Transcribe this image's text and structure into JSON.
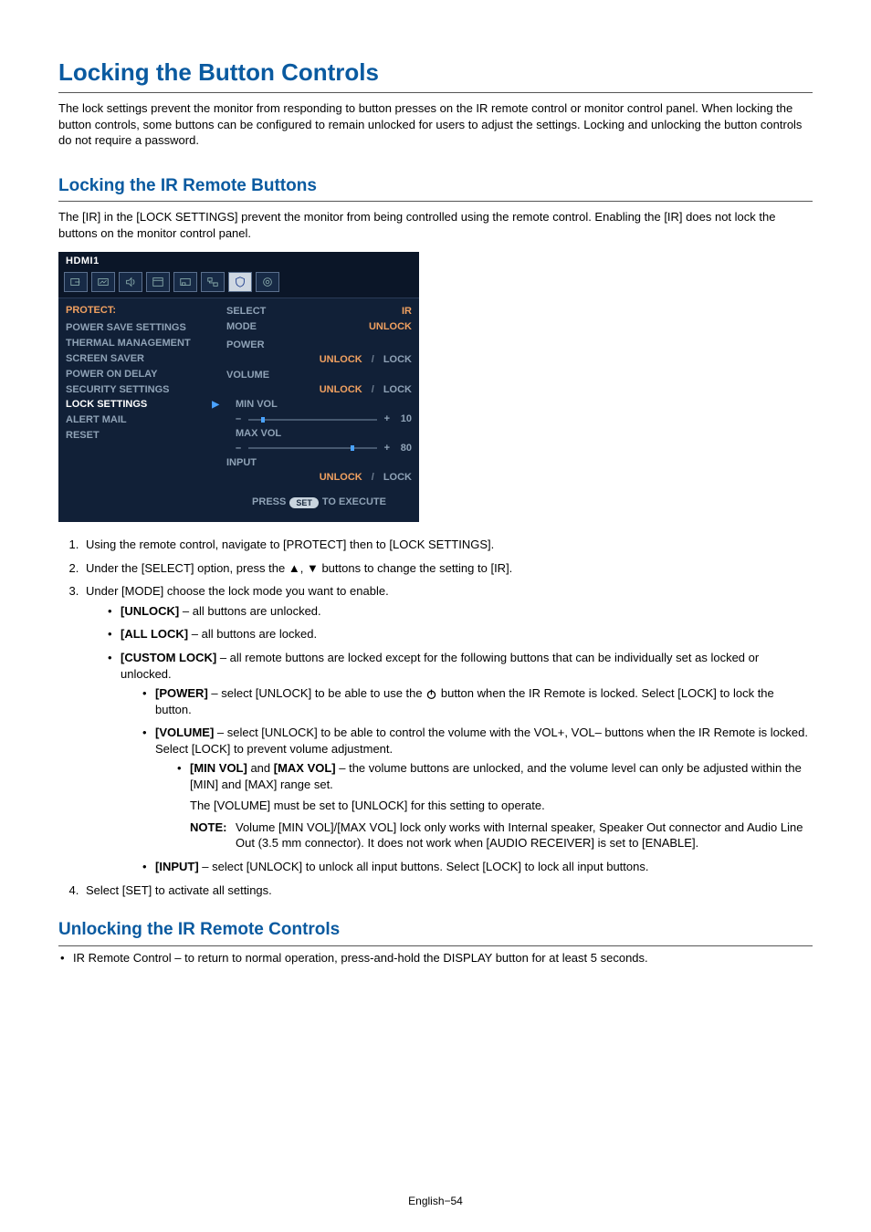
{
  "title": "Locking the Button Controls",
  "intro": "The lock settings prevent the monitor from responding to button presses on the IR remote control or monitor control panel. When locking the button controls, some buttons can be configured to remain unlocked for users to adjust the settings. Locking and unlocking the button controls do not require a password.",
  "sec1": {
    "heading": "Locking the IR Remote Buttons",
    "intro": "The [IR] in the [LOCK SETTINGS] prevent the monitor from being controlled using the remote control. Enabling the [IR] does not lock the buttons on the monitor control panel."
  },
  "osd": {
    "input": "HDMI1",
    "category": "PROTECT:",
    "menu": [
      "POWER SAVE SETTINGS",
      "THERMAL MANAGEMENT",
      "SCREEN SAVER",
      "POWER ON DELAY",
      "SECURITY SETTINGS",
      "LOCK SETTINGS",
      "ALERT MAIL",
      "RESET"
    ],
    "selectedIndex": 5,
    "right": {
      "select_label": "SELECT",
      "select_value": "IR",
      "mode_label": "MODE",
      "mode_value": "UNLOCK",
      "power_label": "POWER",
      "power_unlock": "UNLOCK",
      "power_lock": "LOCK",
      "volume_label": "VOLUME",
      "volume_unlock": "UNLOCK",
      "volume_lock": "LOCK",
      "minvol_label": "MIN VOL",
      "minvol_minus": "–",
      "minvol_plus": "+",
      "minvol_value": "10",
      "maxvol_label": "MAX VOL",
      "maxvol_minus": "–",
      "maxvol_plus": "+",
      "maxvol_value": "80",
      "input_label": "INPUT",
      "input_unlock": "UNLOCK",
      "input_lock": "LOCK",
      "slash": "/",
      "press1": "PRESS",
      "press_set": "SET",
      "press2": "TO EXECUTE"
    }
  },
  "steps": {
    "s1": "Using the remote control, navigate to [PROTECT] then to [LOCK SETTINGS].",
    "s2a": "Under the [SELECT] option, press the ",
    "s2_up": "▲",
    "s2_mid": ", ",
    "s2_down": "▼",
    "s2b": " buttons to change the setting to [IR].",
    "s3": "Under [MODE] choose the lock mode you want to enable.",
    "b_unlock_label": "[UNLOCK]",
    "b_unlock_text": " – all buttons are unlocked.",
    "b_alllock_label": "[ALL LOCK]",
    "b_alllock_text": " – all buttons are locked.",
    "b_custom_label": "[CUSTOM LOCK]",
    "b_custom_text": " – all remote buttons are locked except for the following buttons that can be individually set as locked or unlocked.",
    "p_power_label": "[POWER]",
    "p_power_t1": " – select [UNLOCK] to be able to use the ",
    "p_power_t2": " button when the IR Remote is locked. Select [LOCK] to lock the button.",
    "p_volume_label": "[VOLUME]",
    "p_volume_text": " – select [UNLOCK] to be able to control the volume with the VOL+, VOL– buttons when the IR Remote is locked. Select [LOCK] to prevent volume adjustment.",
    "p_minmax_label1": "[MIN VOL]",
    "p_minmax_and": " and ",
    "p_minmax_label2": "[MAX VOL]",
    "p_minmax_text": " – the volume buttons are unlocked, and the volume level can only be adjusted within the [MIN] and [MAX] range set.",
    "p_minmax_extra": "The [VOLUME] must be set to [UNLOCK] for this setting to operate.",
    "note_label": "NOTE:",
    "note_text": "Volume [MIN VOL]/[MAX VOL] lock only works with Internal speaker, Speaker Out connector and Audio Line Out (3.5 mm connector). It does not work when [AUDIO RECEIVER] is set to [ENABLE].",
    "p_input_label": "[INPUT]",
    "p_input_text": " – select [UNLOCK] to unlock all input buttons. Select [LOCK] to lock all input buttons.",
    "s4": "Select [SET] to activate all settings."
  },
  "sec2": {
    "heading": "Unlocking the IR Remote Controls",
    "bullet": "IR Remote Control – to return to normal operation, press-and-hold the DISPLAY button for at least 5 seconds."
  },
  "footer": "English−54",
  "chart_data": {
    "type": "table",
    "title": "OSD LOCK SETTINGS menu state",
    "rows": [
      {
        "setting": "SELECT",
        "value": "IR"
      },
      {
        "setting": "MODE",
        "value": "UNLOCK"
      },
      {
        "setting": "POWER",
        "value": "UNLOCK / LOCK"
      },
      {
        "setting": "VOLUME",
        "value": "UNLOCK / LOCK"
      },
      {
        "setting": "MIN VOL",
        "value": 10
      },
      {
        "setting": "MAX VOL",
        "value": 80
      },
      {
        "setting": "INPUT",
        "value": "UNLOCK / LOCK"
      }
    ]
  }
}
